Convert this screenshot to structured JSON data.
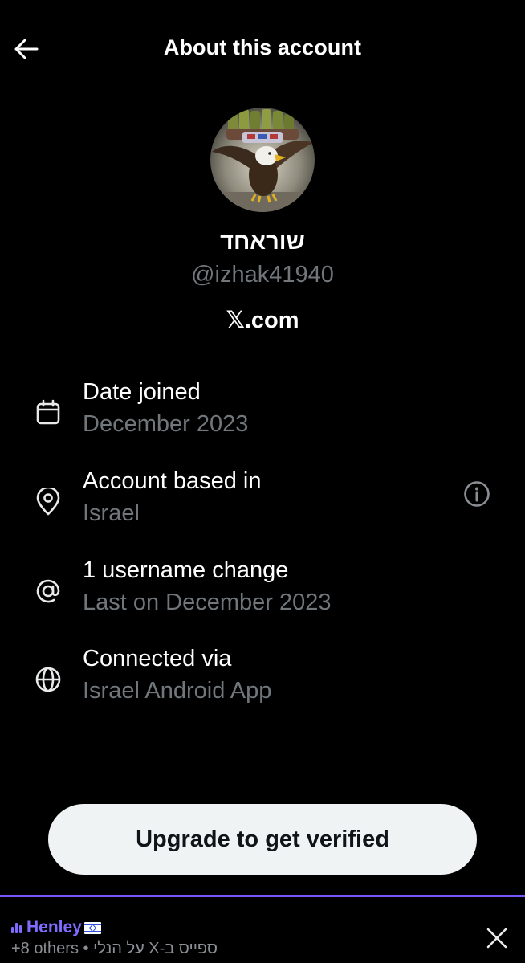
{
  "header": {
    "title": "About this account",
    "back_icon": "arrow-left-icon"
  },
  "profile": {
    "display_name": "שוראחד",
    "handle": "@izhak41940",
    "platform": "𝕏.com"
  },
  "rows": [
    {
      "icon": "calendar-icon",
      "title": "Date joined",
      "subtitle": "December 2023"
    },
    {
      "icon": "location-pin-icon",
      "title": "Account based in",
      "subtitle": "Israel",
      "info_icon": "info-icon"
    },
    {
      "icon": "at-sign-icon",
      "title": "1 username change",
      "subtitle": "Last on December 2023"
    },
    {
      "icon": "globe-icon",
      "title": "Connected via",
      "subtitle": "Israel Android App"
    }
  ],
  "upgrade": {
    "label": "Upgrade to get verified"
  },
  "spaces_bar": {
    "host": "Henley",
    "flag": "🇮🇱",
    "others": "+8 others",
    "separator": " • ",
    "space_title": "ספייס ב-X על הנלי",
    "close_icon": "close-icon"
  },
  "colors": {
    "background": "#000000",
    "primary_text": "#e7e9ea",
    "secondary_text": "#71767b",
    "button_bg": "#eff3f4",
    "spaces_accent": "#7856ff"
  }
}
